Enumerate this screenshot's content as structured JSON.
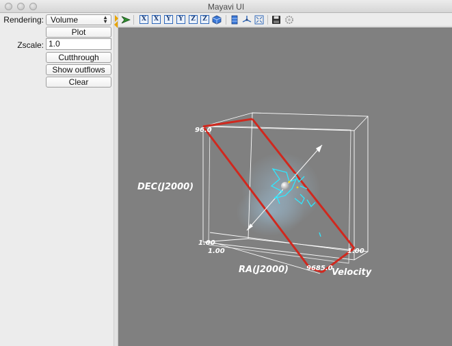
{
  "window": {
    "title": "Mayavi UI"
  },
  "controls": {
    "rendering_label": "Rendering:",
    "rendering_value": "Volume",
    "plot_label": "Plot",
    "zscale_label": "Zscale:",
    "zscale_value": "1.0",
    "cutthrough_label": "Cutthrough",
    "show_outflows_label": "Show outflows",
    "clear_label": "Clear"
  },
  "toolbar": {
    "items": [
      "mayavi-logo-icon",
      "view-minus-x",
      "view-plus-x",
      "view-minus-y",
      "view-plus-y",
      "view-minus-z",
      "view-plus-z",
      "isometric-view",
      "toggle-axes",
      "toggle-orientation-axes",
      "full-screen",
      "save-scene",
      "configure-scene"
    ],
    "view_letters": [
      "X",
      "X",
      "Y",
      "Y",
      "Z",
      "Z"
    ]
  },
  "scene": {
    "axis_labels": {
      "dec": "DEC(J2000)",
      "ra": "RA(J2000)",
      "velocity": "Velocity"
    },
    "tick_labels": {
      "dec_top": "96.0",
      "dec_bottom": "1.00",
      "ra_start": "1.00",
      "ra_end_overlap": "9685.0",
      "vel_end": "1.00"
    },
    "colors": {
      "background": "#808080",
      "outline": "#ffffff",
      "cut_plane": "#d0281e",
      "contour": "#2ee8ff"
    }
  }
}
